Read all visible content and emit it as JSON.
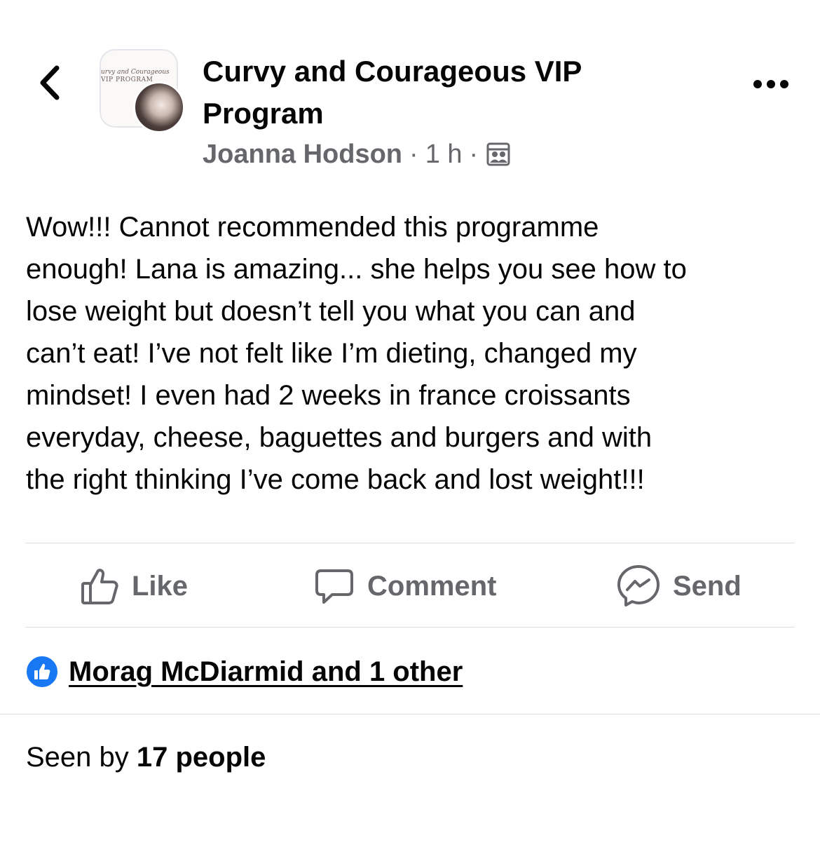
{
  "header": {
    "title": "Curvy and Courageous VIP Program",
    "avatar_logo_line1": "urvy and Courageous",
    "avatar_logo_line2": "VIP PROGRAM",
    "back_icon": "chevron-left-icon",
    "more_icon": "more-horizontal-icon"
  },
  "meta": {
    "author": "Joanna Hodson",
    "separator": "·",
    "time": "1 h",
    "privacy_icon": "members-group-icon"
  },
  "post": {
    "text": "Wow!!! Cannot recommended this programme\nenough! Lana is amazing... she helps you see how to\nlose weight but doesn’t tell you what you can and\ncan’t eat! I’ve not felt like I’m dieting, changed my\nmindset! I even had 2 weeks in france croissants\neveryday, cheese, baguettes and burgers and with\nthe right thinking I’ve come back and lost weight!!!"
  },
  "actions": {
    "like_label": "Like",
    "comment_label": "Comment",
    "send_label": "Send",
    "like_icon": "thumbs-up-outline-icon",
    "comment_icon": "speech-bubble-icon",
    "send_icon": "messenger-icon"
  },
  "reactions": {
    "text": "Morag McDiarmid and 1 other",
    "icon": "like-reaction-icon",
    "icon_color": "#1877f2"
  },
  "seen": {
    "prefix": "Seen by ",
    "count": "17 people"
  },
  "colors": {
    "text_primary": "#050505",
    "text_secondary": "#65676b",
    "divider": "#dadde1",
    "brand_blue": "#1877f2"
  }
}
